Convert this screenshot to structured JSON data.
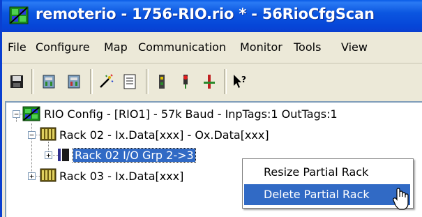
{
  "window": {
    "title": "remoterio - 1756-RIO.rio * - 56RioCfgScan",
    "app_icon": "network-config-icon"
  },
  "menu": {
    "items": [
      "File",
      "Configure",
      "Map",
      "Communication",
      "Monitor",
      "Tools",
      "View"
    ]
  },
  "toolbar": {
    "buttons": [
      "save-icon",
      "download-icon",
      "upload-icon",
      "wizard-icon",
      "document-icon",
      "io-module-icon",
      "status-light-icon",
      "connect-icon",
      "context-help-icon"
    ]
  },
  "tree": {
    "root": {
      "label": "RIO Config - [RIO1] -  57k Baud - InpTags:1 OutTags:1",
      "expander": "−"
    },
    "rack02": {
      "label": "Rack 02 - Ix.Data[xxx] - Ox.Data[xxx]",
      "expander": "−"
    },
    "rack02_grp": {
      "label": "Rack 02 I/O Grp 2->3",
      "expander": "+"
    },
    "rack03": {
      "label": "Rack 03 - Ix.Data[xxx]",
      "expander": "+"
    }
  },
  "context_menu": {
    "items": [
      "Resize Partial Rack",
      "Delete Partial Rack"
    ],
    "highlighted": "Delete Partial Rack"
  },
  "colors": {
    "titlebar": "#0a5ce6",
    "selection": "#316ac5",
    "chrome": "#ece9d8"
  }
}
